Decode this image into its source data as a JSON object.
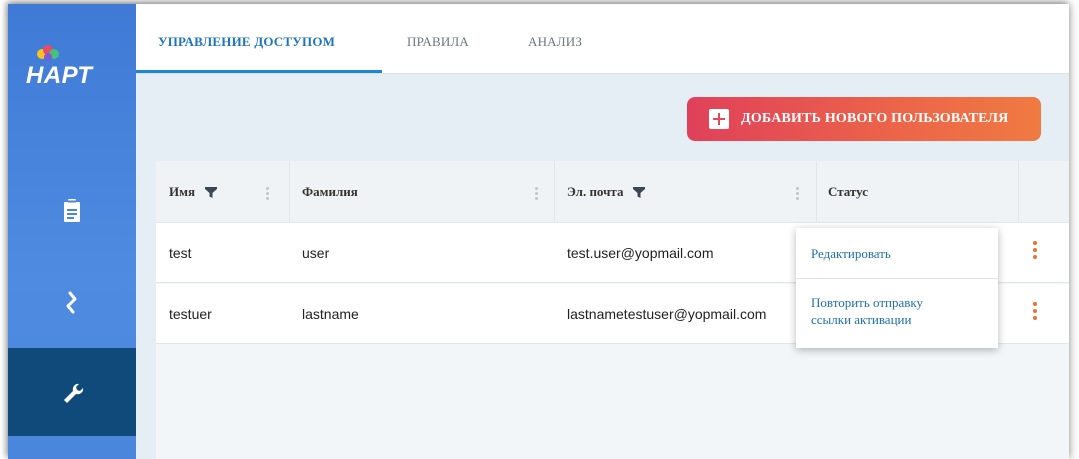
{
  "app": {
    "logo_text": "НАРТ",
    "brand_colors": {
      "sidebar": "#4a86dc",
      "sidebar_active": "#0f4a7a",
      "accent": "#1d88d1",
      "button_start": "#e0405a",
      "button_end": "#f07a42",
      "kebab": "#e8722f"
    }
  },
  "sidebar": {
    "items": [
      {
        "icon": "clipboard-icon",
        "active": false
      },
      {
        "icon": "flow-icon",
        "active": false
      },
      {
        "icon": "wrench-icon",
        "active": true
      }
    ]
  },
  "tabs": [
    {
      "label": "УПРАВЛЕНИЕ ДОСТУПОМ",
      "active": true
    },
    {
      "label": "ПРАВИЛА",
      "active": false
    },
    {
      "label": "АНАЛИЗ",
      "active": false
    }
  ],
  "toolbar": {
    "add_user_label": "ДОБАВИТЬ НОВОГО ПОЛЬЗОВАТЕЛЯ"
  },
  "table": {
    "columns": [
      "Имя",
      "Фамилия",
      "Эл. почта",
      "Статус"
    ],
    "rows": [
      {
        "first_name": "test",
        "last_name": "user",
        "email": "test.user@yopmail.com"
      },
      {
        "first_name": "testuer",
        "last_name": "lastname",
        "email": "lastnametestuser@yopmail.com"
      }
    ]
  },
  "context_menu": {
    "edit_label": "Редактировать",
    "resend_line1": "Повторить отправку",
    "resend_line2": "ссылки активации"
  }
}
